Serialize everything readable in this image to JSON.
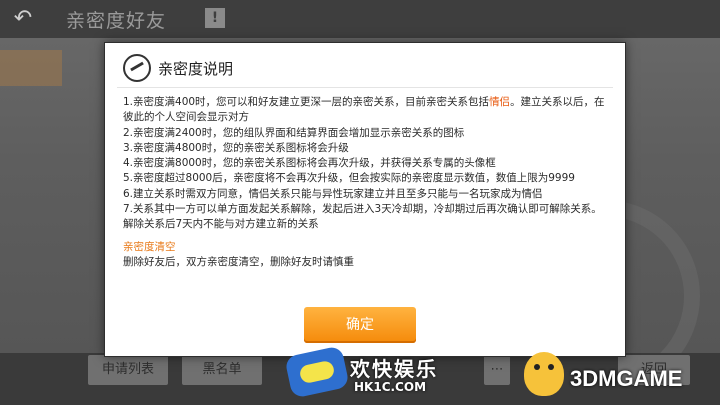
{
  "background": {
    "title": "亲密度好友",
    "info_badge": "!",
    "bottom_buttons": [
      "申请列表",
      "黑名单",
      "返回"
    ]
  },
  "modal": {
    "title": "亲密度说明",
    "rules": [
      "1.亲密度满400时，您可以和好友建立更深一层的亲密关系，目前亲密关系包括",
      "情侣",
      "。建立关系以后，在彼此的个人空间会显示对方",
      "2.亲密度满2400时，您的组队界面和结算界面会增加显示亲密关系的图标",
      "3.亲密度满4800时，您的亲密关系图标将会升级",
      "4.亲密度满8000时，您的亲密关系图标将会再次升级，并获得关系专属的头像框",
      "5.亲密度超过8000后，亲密度将不会再次升级，但会按实际的亲密度显示数值，数值上限为9999",
      "6.建立关系时需双方同意，情侣关系只能与异性玩家建立并且至多只能与一名玩家成为情侣",
      "7.关系其中一方可以单方面发起关系解除，发起后进入3天冷却期，冷却期过后再次确认即可解除关系。解除关系后7天内不能与对方建立新的关系"
    ],
    "clear_title": "亲密度清空",
    "clear_text": "删除好友后，双方亲密度清空，删除好友时请慎重",
    "confirm_label": "确定"
  },
  "watermarks": {
    "site1_name": "欢快娱乐",
    "site1_url": "HK1C.COM",
    "site2_name": "3DMGAME"
  },
  "colors": {
    "highlight": "#e85a10",
    "section_title": "#e87a1a",
    "confirm_button": "#f58a0a"
  }
}
